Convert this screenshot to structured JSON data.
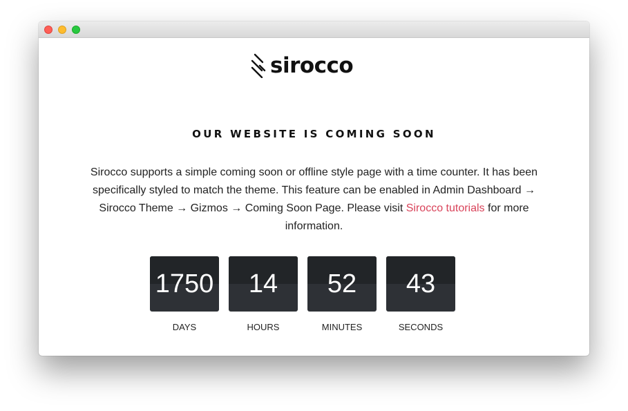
{
  "brand": {
    "logo_text": "sirocco"
  },
  "page": {
    "heading": "OUR WEBSITE IS COMING SOON",
    "description_before_link": "Sirocco supports a simple coming soon or offline style page with a time counter. It has been specifically styled to match the theme. This feature can be enabled in Admin Dashboard → Sirocco Theme → Gizmos → Coming Soon Page. Please visit ",
    "link_text": "Sirocco tutorials",
    "description_after_link": " for more information."
  },
  "countdown": {
    "days": {
      "value": "1750",
      "label": "DAYS"
    },
    "hours": {
      "value": "14",
      "label": "HOURS"
    },
    "minutes": {
      "value": "52",
      "label": "MINUTES"
    },
    "seconds": {
      "value": "43",
      "label": "SECONDS"
    }
  },
  "colors": {
    "link": "#d9435a",
    "counter_bg": "#2e3136",
    "close": "#fe5f57",
    "minimize": "#febc2e",
    "maximize": "#28c840"
  },
  "icons": {
    "logo_mark": "sirocco-wind-lines-icon"
  }
}
